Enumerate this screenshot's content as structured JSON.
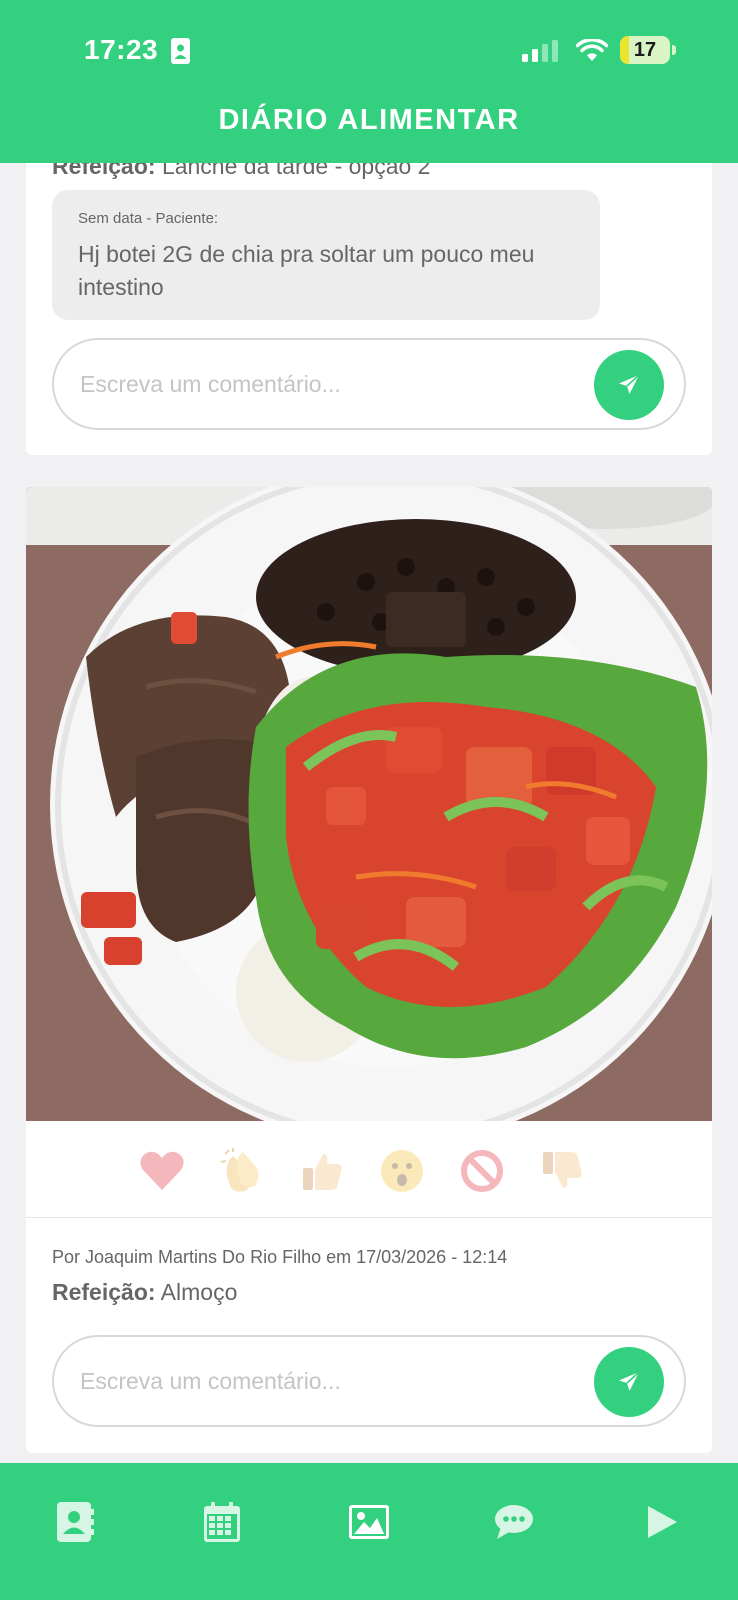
{
  "status_bar": {
    "time": "17:23",
    "battery": "17",
    "battery_level": 0.17
  },
  "header": {
    "title": "DIÁRIO ALIMENTAR"
  },
  "post1": {
    "meal_label": "Refeição:",
    "meal_value": "Lanche da tarde - opção 2",
    "comment_meta": "Sem data - Paciente:",
    "comment_text": "Hj botei 2G de chia pra soltar um pouco meu intestino",
    "comment_placeholder": "Escreva um comentário..."
  },
  "post2": {
    "reactions": [
      "heart",
      "clap",
      "thumbs-up",
      "surprised",
      "prohibited",
      "thumbs-down"
    ],
    "author_line": "Por Joaquim Martins Do Rio Filho em 17/03/2026 - 12:14",
    "meal_label": "Refeição:",
    "meal_value": "Almoço",
    "comment_placeholder": "Escreva um comentário..."
  },
  "bottom_nav": [
    "contacts-icon",
    "calendar-icon",
    "image-icon",
    "chat-icon",
    "play-icon"
  ],
  "colors": {
    "brand": "#33d17f",
    "background": "#f1f1f4"
  }
}
